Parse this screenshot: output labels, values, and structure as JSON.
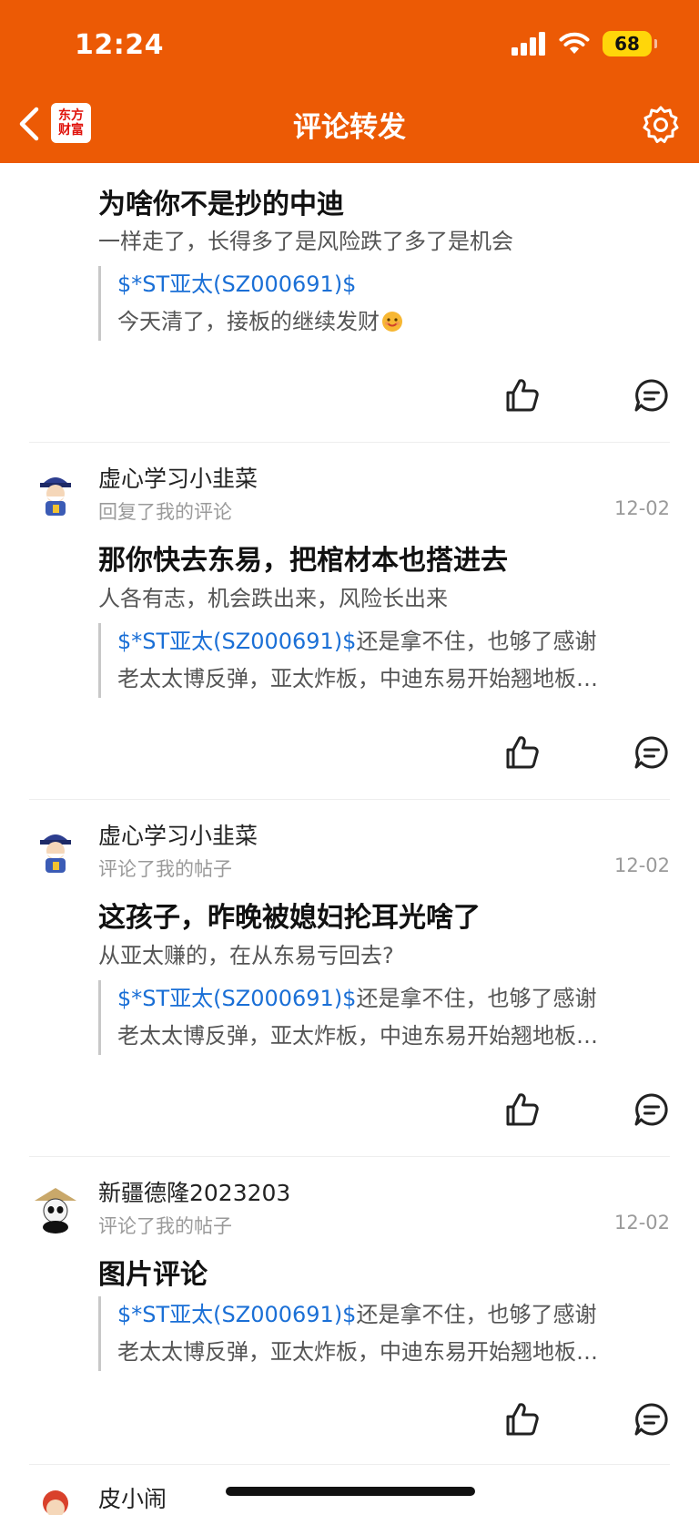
{
  "status": {
    "time": "12:24",
    "battery": "68"
  },
  "header": {
    "title": "评论转发",
    "logo_line1": "东方",
    "logo_line2": "财富"
  },
  "items": [
    {
      "reply": "为啥你不是抄的中迪",
      "original": "一样走了，长得多了是风险跌了多了是机会",
      "quote_ticker": "$*ST亚太(SZ000691)$",
      "quote_rest": "",
      "quote_line2": "今天清了，接板的继续发财"
    },
    {
      "user": "虚心学习小韭菜",
      "action": "回复了我的评论",
      "date": "12-02",
      "reply": "那你快去东易，把棺材本也搭进去",
      "original": "人各有志，机会跌出来，风险长出来",
      "quote_ticker": "$*ST亚太(SZ000691)$",
      "quote_rest": "还是拿不住，也够了感谢",
      "quote_line2": "老太太博反弹，亚太炸板，中迪东易开始翘地板…"
    },
    {
      "user": "虚心学习小韭菜",
      "action": "评论了我的帖子",
      "date": "12-02",
      "reply": "这孩子，昨晚被媳妇抡耳光啥了",
      "original": "从亚太赚的，在从东易亏回去?",
      "quote_ticker": "$*ST亚太(SZ000691)$",
      "quote_rest": "还是拿不住，也够了感谢",
      "quote_line2": "老太太博反弹，亚太炸板，中迪东易开始翘地板…"
    },
    {
      "user": "新疆德隆2023203",
      "action": "评论了我的帖子",
      "date": "12-02",
      "reply": "图片评论",
      "quote_ticker": "$*ST亚太(SZ000691)$",
      "quote_rest": "还是拿不住，也够了感谢",
      "quote_line2": "老太太博反弹，亚太炸板，中迪东易开始翘地板…"
    },
    {
      "user": "皮小闹"
    }
  ],
  "icons": {
    "back": "chevron-left-icon",
    "settings": "gear-icon",
    "like": "thumbs-up-icon",
    "comment": "comment-bubble-icon"
  },
  "colors": {
    "header_bg": "#EC5A05",
    "ticker": "#1a6fd6",
    "battery": "#FFD60A"
  }
}
